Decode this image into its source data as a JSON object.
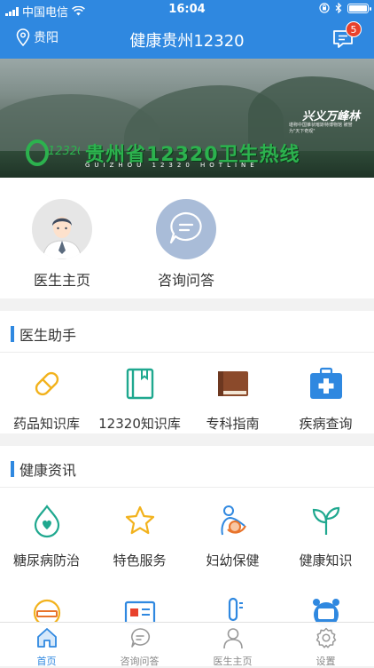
{
  "status_bar": {
    "carrier": "中国电信",
    "time": "16:04"
  },
  "nav": {
    "location": "贵阳",
    "title": "健康贵州12320",
    "message_badge": "5"
  },
  "banner": {
    "headline": "贵州省12320卫生热线",
    "subline": "GUIZHOU 12320 HOTLINE",
    "corner_title": "兴义万峰林",
    "corner_note": "堪称中国锥状喀斯特博物馆 被誉为\"天下奇观\""
  },
  "quick_entries": [
    {
      "label": "医生主页",
      "icon": "doctor-avatar-icon"
    },
    {
      "label": "咨询问答",
      "icon": "chat-bubble-icon"
    }
  ],
  "doctor_assistant": {
    "heading": "医生助手",
    "items": [
      {
        "label": "药品知识库",
        "icon": "pill-icon",
        "color": "#f2b21c"
      },
      {
        "label": "12320知识库",
        "icon": "book-icon",
        "color": "#1fa88f"
      },
      {
        "label": "专科指南",
        "icon": "guide-book-icon",
        "color": "#8b4a2b"
      },
      {
        "label": "疾病查询",
        "icon": "medical-kit-icon",
        "color": "#2f88e0"
      }
    ]
  },
  "health_news": {
    "heading": "健康资讯",
    "items": [
      {
        "label": "糖尿病防治",
        "icon": "drop-heart-icon",
        "color": "#1fa88f"
      },
      {
        "label": "特色服务",
        "icon": "star-icon",
        "color": "#f2b21c"
      },
      {
        "label": "妇幼保健",
        "icon": "mother-baby-icon",
        "color": "#e8742c"
      },
      {
        "label": "健康知识",
        "icon": "sprout-icon",
        "color": "#1fa88f"
      }
    ],
    "more_icons": [
      "cigarette-icon",
      "id-card-icon",
      "thermometer-icon",
      "medicine-alarm-icon"
    ]
  },
  "tabbar": [
    {
      "label": "首页",
      "icon": "home-icon",
      "active": true
    },
    {
      "label": "咨询问答",
      "icon": "chat-tab-icon",
      "active": false
    },
    {
      "label": "医生主页",
      "icon": "person-tab-icon",
      "active": false
    },
    {
      "label": "设置",
      "icon": "settings-tab-icon",
      "active": false
    }
  ],
  "colors": {
    "primary": "#2f88e0",
    "badge": "#e8412c"
  }
}
